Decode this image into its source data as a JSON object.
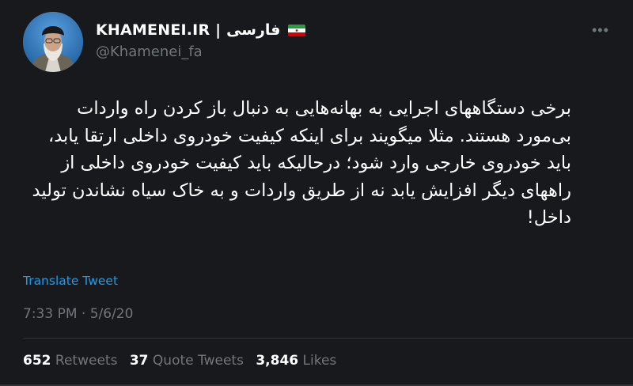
{
  "author": {
    "display_name": "KHAMENEI.IR | فارسی",
    "handle": "@Khamenei_fa",
    "flag": "iran-flag-icon"
  },
  "tweet": {
    "text": "برخی دستگاههای اجرایی به بهانه‌هایی به دنبال باز کردن راه واردات بی‌مورد هستند. مثلا میگویند برای اینکه کیفیت خودروی داخلی ارتقا یابد، باید خودروی خارجی وارد شود؛ درحالیکه باید کیفیت خودروی داخلی از راههای دیگر افزایش یابد نه از طریق واردات و به خاک سیاه نشاندن تولید داخل!",
    "translate_label": "Translate Tweet",
    "time": "7:33 PM",
    "separator": "·",
    "date": "5/6/20"
  },
  "stats": {
    "retweets_count": "652",
    "retweets_label": "Retweets",
    "quotes_count": "37",
    "quotes_label": "Quote Tweets",
    "likes_count": "3,846",
    "likes_label": "Likes"
  },
  "icons": {
    "more": "more-options-icon"
  },
  "colors": {
    "background": "#17191d",
    "text": "#ffffff",
    "secondary": "#71767b",
    "link": "#1d9bf0"
  }
}
